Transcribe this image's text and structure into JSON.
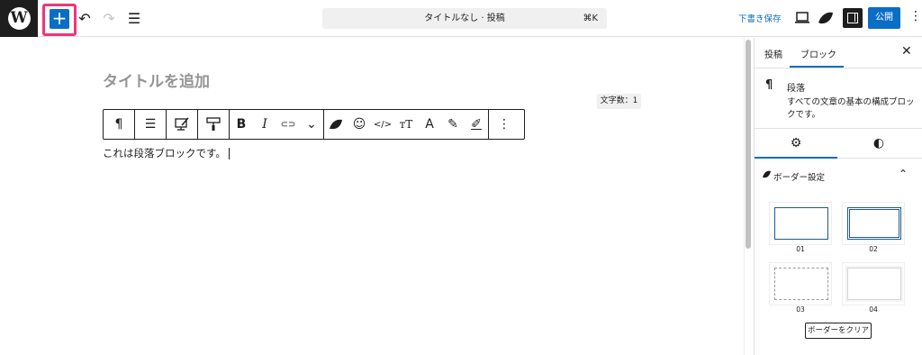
{
  "topbar": {
    "logo_glyph": "W",
    "add_block_glyph": "+",
    "undo_glyph": "↶",
    "redo_glyph": "↷",
    "document_overview_glyph": "☰",
    "document_title": "タイトルなし · 投稿",
    "command_shortcut": "⌘K",
    "save_draft_label": "下書き保存",
    "publish_label": "公開",
    "more_glyph": "⋮",
    "accent_color": "#0a6ec6",
    "highlight_color": "#f0347a"
  },
  "editor": {
    "title_placeholder": "タイトルを追加",
    "char_count": "文字数：1",
    "paragraph_text": "これは段落ブロックです。",
    "block_toolbar": {
      "paragraph_glyph": "¶",
      "align_glyph": "☰",
      "bold_glyph": "B",
      "italic_glyph": "I",
      "link_glyph": "⊂⊃",
      "more_rich_glyph": "⌄",
      "emoji_glyph": "☺",
      "code_glyph": "</>",
      "font_size_glyph": "ᴛT",
      "text_color_glyph": "A",
      "highlighter_glyph": "✎",
      "options_glyph": "⋮"
    }
  },
  "sidebar": {
    "tabs": [
      "投稿",
      "ブロック"
    ],
    "close_glyph": "✕",
    "block_icon_glyph": "¶",
    "block_name": "段落",
    "block_description": "すべての文章の基本の構成ブロックです。",
    "subtab_settings_glyph": "⚙",
    "subtab_styles_glyph": "◐",
    "panel_title": "ボーダー設定",
    "panel_caret_glyph": "⌃",
    "border_options": [
      "01",
      "02",
      "03",
      "04"
    ],
    "clear_label": "ボーダーをクリア"
  }
}
